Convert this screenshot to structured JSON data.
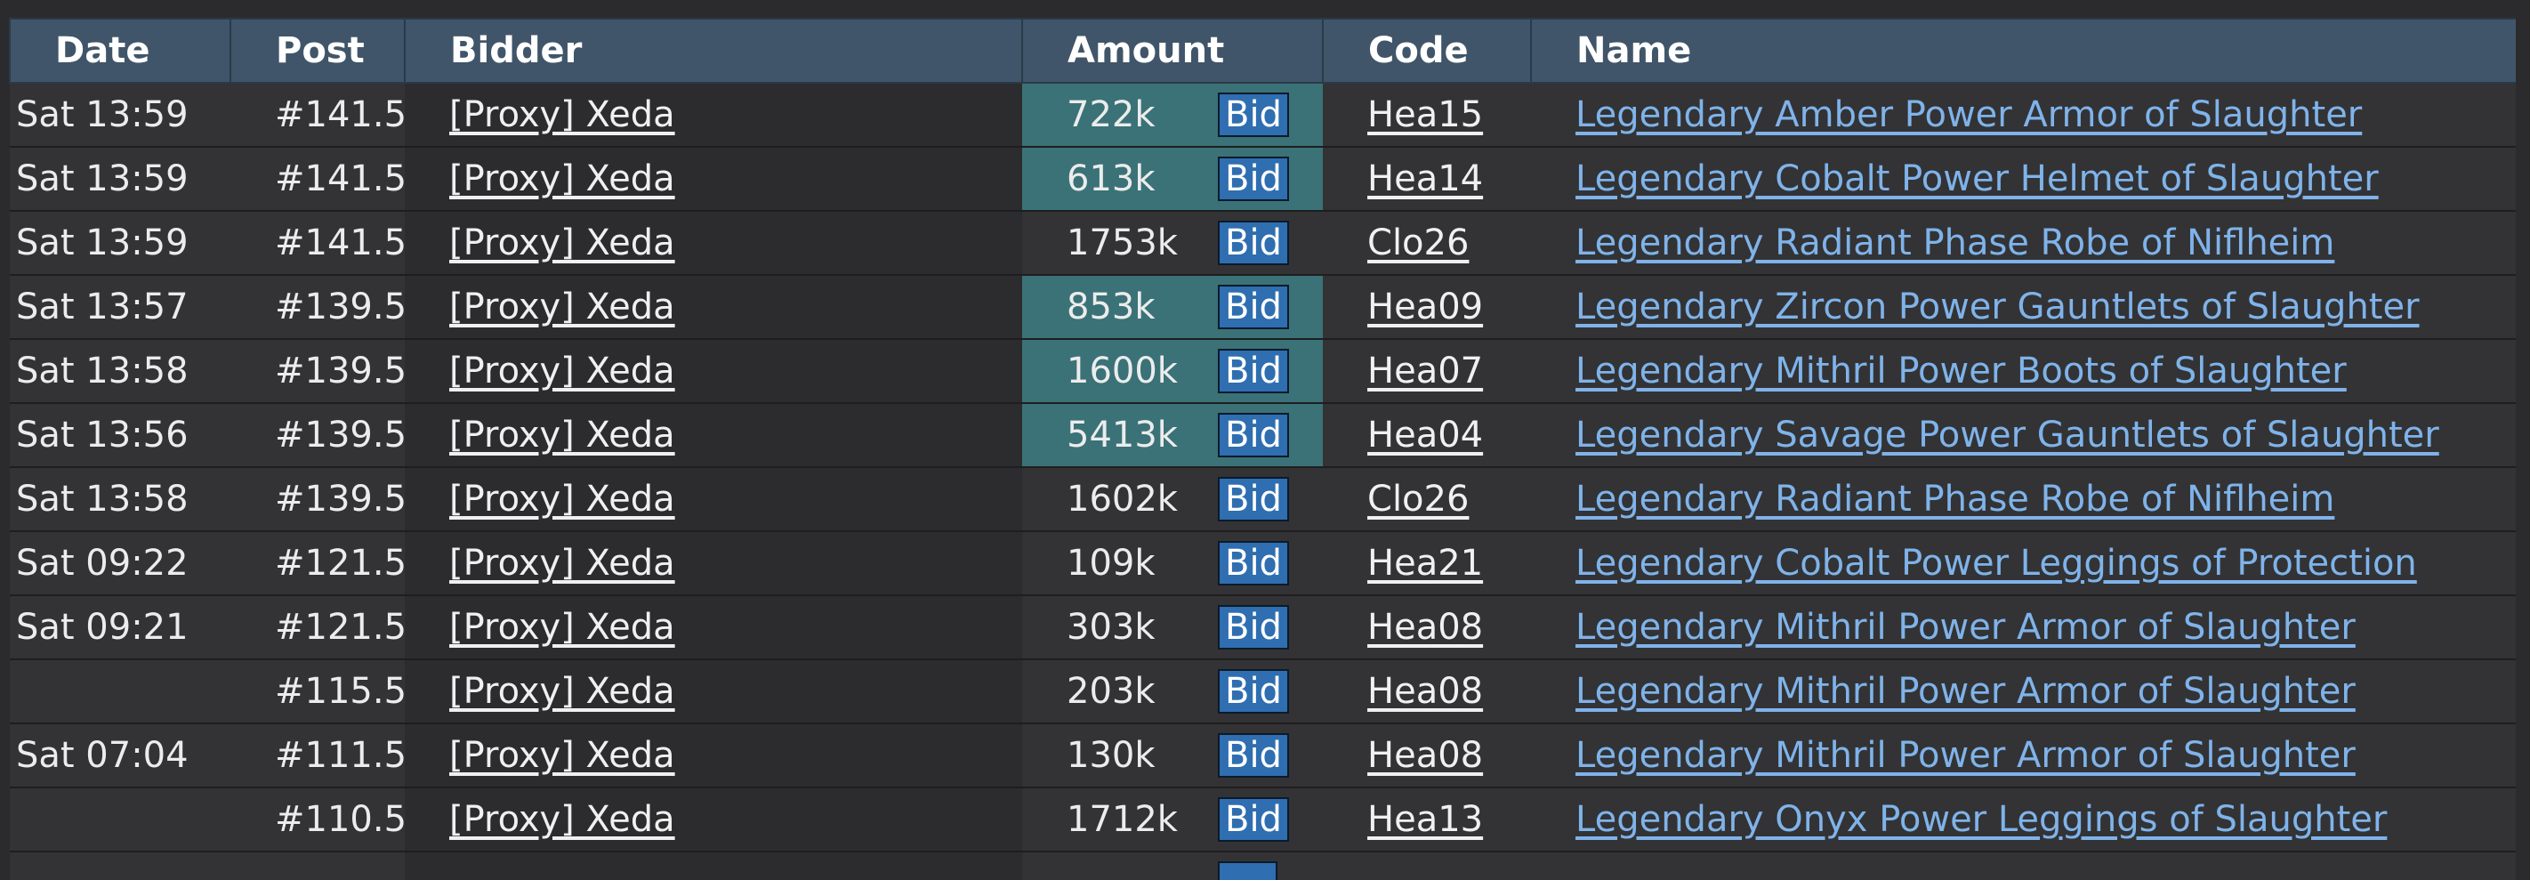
{
  "headers": {
    "date": "Date",
    "post": "Post",
    "bidder": "Bidder",
    "amount": "Amount",
    "code": "Code",
    "name": "Name"
  },
  "colors": {
    "header_bg": "#405569",
    "row_bg": "#333335",
    "bidder_col_bg": "#2c2c2e",
    "highlight_amount_bg": "#3a7277",
    "bid_button_bg": "#2f6eb0",
    "name_link": "#7fb3ea"
  },
  "rows": [
    {
      "date": "Sat 13:59",
      "post": "#141.5",
      "bidder": "[Proxy] Xeda",
      "amount": "722k",
      "bid": "Bid",
      "code": "Hea15",
      "name": "Legendary Amber Power Armor of Slaughter",
      "highlight": true
    },
    {
      "date": "Sat 13:59",
      "post": "#141.5",
      "bidder": "[Proxy] Xeda",
      "amount": "613k",
      "bid": "Bid",
      "code": "Hea14",
      "name": "Legendary Cobalt Power Helmet of Slaughter",
      "highlight": true
    },
    {
      "date": "Sat 13:59",
      "post": "#141.5",
      "bidder": "[Proxy] Xeda",
      "amount": "1753k",
      "bid": "Bid",
      "code": "Clo26",
      "name": "Legendary Radiant Phase Robe of Niflheim",
      "highlight": false
    },
    {
      "date": "Sat 13:57",
      "post": "#139.5",
      "bidder": "[Proxy] Xeda",
      "amount": "853k",
      "bid": "Bid",
      "code": "Hea09",
      "name": "Legendary Zircon Power Gauntlets of Slaughter",
      "highlight": true
    },
    {
      "date": "Sat 13:58",
      "post": "#139.5",
      "bidder": "[Proxy] Xeda",
      "amount": "1600k",
      "bid": "Bid",
      "code": "Hea07",
      "name": "Legendary Mithril Power Boots of Slaughter",
      "highlight": true
    },
    {
      "date": "Sat 13:56",
      "post": "#139.5",
      "bidder": "[Proxy] Xeda",
      "amount": "5413k",
      "bid": "Bid",
      "code": "Hea04",
      "name": "Legendary Savage Power Gauntlets of Slaughter",
      "highlight": true
    },
    {
      "date": "Sat 13:58",
      "post": "#139.5",
      "bidder": "[Proxy] Xeda",
      "amount": "1602k",
      "bid": "Bid",
      "code": "Clo26",
      "name": "Legendary Radiant Phase Robe of Niflheim",
      "highlight": false
    },
    {
      "date": "Sat 09:22",
      "post": "#121.5",
      "bidder": "[Proxy] Xeda",
      "amount": "109k",
      "bid": "Bid",
      "code": "Hea21",
      "name": "Legendary Cobalt Power Leggings of Protection",
      "highlight": false
    },
    {
      "date": "Sat 09:21",
      "post": "#121.5",
      "bidder": "[Proxy] Xeda",
      "amount": "303k",
      "bid": "Bid",
      "code": "Hea08",
      "name": "Legendary Mithril Power Armor of Slaughter",
      "highlight": false
    },
    {
      "date": "",
      "post": "#115.5",
      "bidder": "[Proxy] Xeda",
      "amount": "203k",
      "bid": "Bid",
      "code": "Hea08",
      "name": "Legendary Mithril Power Armor of Slaughter",
      "highlight": false
    },
    {
      "date": "Sat 07:04",
      "post": "#111.5",
      "bidder": "[Proxy] Xeda",
      "amount": "130k",
      "bid": "Bid",
      "code": "Hea08",
      "name": "Legendary Mithril Power Armor of Slaughter",
      "highlight": false
    },
    {
      "date": "",
      "post": "#110.5",
      "bidder": "[Proxy] Xeda",
      "amount": "1712k",
      "bid": "Bid",
      "code": "Hea13",
      "name": "Legendary Onyx Power Leggings of Slaughter",
      "highlight": false
    },
    {
      "date": "",
      "post": "",
      "bidder": "",
      "amount": "",
      "bid": "",
      "code": "",
      "name": "",
      "highlight": false
    }
  ]
}
